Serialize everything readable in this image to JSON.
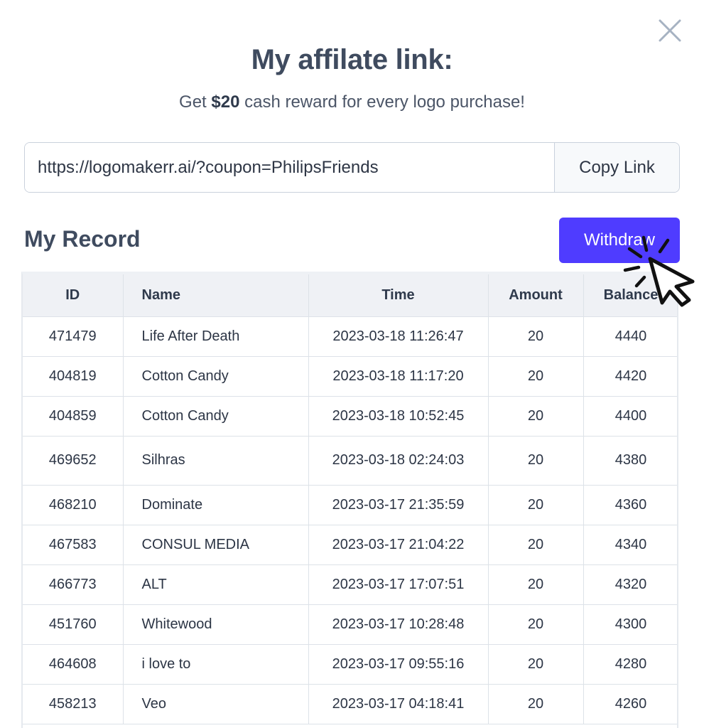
{
  "modal": {
    "title": "My affilate link:",
    "subtitle_prefix": "Get ",
    "subtitle_bold": "$20",
    "subtitle_suffix": " cash reward for every logo purchase!",
    "link_value": "https://logomakerr.ai/?coupon=PhilipsFriends",
    "copy_label": "Copy Link",
    "close_icon": "close-icon"
  },
  "record": {
    "title": "My Record",
    "withdraw_label": "Withdraw",
    "columns": [
      "ID",
      "Name",
      "Time",
      "Amount",
      "Balance"
    ],
    "rows": [
      [
        "471479",
        "Life After Death",
        "2023-03-18 11:26:47",
        "20",
        "4440"
      ],
      [
        "404819",
        "Cotton Candy",
        "2023-03-18 11:17:20",
        "20",
        "4420"
      ],
      [
        "404859",
        "Cotton Candy",
        "2023-03-18 10:52:45",
        "20",
        "4400"
      ],
      [
        "469652",
        "Silhras",
        "2023-03-18 02:24:03",
        "20",
        "4380"
      ],
      [
        "468210",
        "Dominate",
        "2023-03-17 21:35:59",
        "20",
        "4360"
      ],
      [
        "467583",
        "CONSUL MEDIA",
        "2023-03-17 21:04:22",
        "20",
        "4340"
      ],
      [
        "466773",
        "ALT",
        "2023-03-17 17:07:51",
        "20",
        "4320"
      ],
      [
        "451760",
        "Whitewood",
        "2023-03-17 10:28:48",
        "20",
        "4300"
      ],
      [
        "464608",
        "i love to",
        "2023-03-17 09:55:16",
        "20",
        "4280"
      ],
      [
        "458213",
        "Veo",
        "2023-03-17 04:18:41",
        "20",
        "4260"
      ]
    ]
  },
  "colors": {
    "accent": "#4f3cff",
    "header_bg": "#eff1f5",
    "text": "#3f4b5f"
  }
}
